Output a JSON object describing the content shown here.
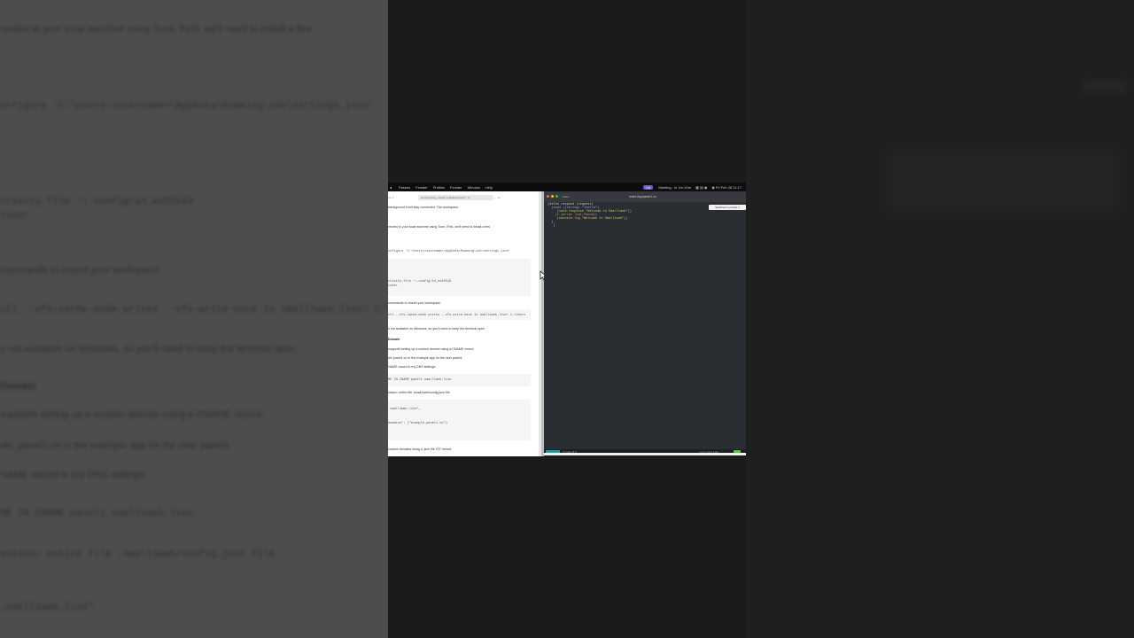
{
  "background_left": {
    "lines": [
      {
        "text": "nected to your local machine using Tunn. First, we'll need to install a few",
        "style": "text"
      },
      {
        "text": "onfigure 'C:\\Users\\<username>\\AppData\\Roaming\\ide\\settings.json'",
        "style": "mono"
      },
      {
        "text": "ctivity-file ~\\.config\\id_ed25519",
        "style": "mono"
      },
      {
        "text": "tuser",
        "style": "mono"
      },
      {
        "text": "commands to mount your workspace:",
        "style": "text"
      },
      {
        "text": "ctl --vfs-cache-mode writes --vfs-write-back 1s small1web_live\\ C:\\Users",
        "style": "mono"
      },
      {
        "text": "s not available on Windows, so you'll need to keep the terminal open",
        "style": "text"
      },
      {
        "text": "Domain",
        "style": "bold"
      },
      {
        "text": "supports setting up a custom domain using a CNAME record.",
        "style": "text"
      },
      {
        "text": "ain_panel1.vo in the example app for the user panel1",
        "style": "text"
      },
      {
        "text": "NAME record in my DNS settings:",
        "style": "text"
      },
      {
        "text": "ME IN CNAME panel1.small1web.live.",
        "style": "mono"
      },
      {
        "text": "ession: entire file .small1web/config.json file",
        "style": "mono"
      },
      {
        "text": ".small1web.live\"",
        "style": "mono"
      }
    ]
  },
  "menubar": {
    "apple": "●",
    "items": [
      "Passes",
      "Fenster",
      "Profiles",
      "Fenster",
      "Window",
      "Help"
    ],
    "pill": "OA",
    "status": [
      "Meeting · in 1hr 20m",
      "▦ ▤ ◉",
      "◉ Fri Feb 28 11:17"
    ]
  },
  "browser": {
    "toolbar_left": "◂ ▸ ⟳",
    "url": "summarizing_panel1.small1web.live/?.. ✕",
    "toolbar_right": "⋯ ⊞",
    "lines": [
      {
        "text": "background it will stay connected. The workspace.",
        "style": "text"
      },
      {
        "text": "nected to your local machine using Tunn. First, we'll need to install a few",
        "style": "text"
      },
      {
        "text": "onfigure 'C:\\Users\\<username>\\AppData\\Roaming\\ide\\settings.json'",
        "style": "mono"
      },
      {
        "text": "ctivity-file ~\\.config\\id_ed25519",
        "style": "mono"
      },
      {
        "text": "tuser",
        "style": "mono"
      },
      {
        "text": "commands to mount your workspace:",
        "style": "text"
      },
      {
        "text": "ctl --vfs-cache-mode writes --vfs-write-back 1s small1web_live\\ C:\\Users",
        "style": "mono"
      },
      {
        "text": "s not available on Windows, so you'll need to keep the terminal open",
        "style": "text"
      },
      {
        "text": "Domain",
        "style": "bold"
      },
      {
        "text": "supports setting up a custom domain using a CNAME record.",
        "style": "text"
      },
      {
        "text": "ain panel1.vo in the example app for the user panel1",
        "style": "text"
      },
      {
        "text": "NAME record in my DNS settings:",
        "style": "text"
      },
      {
        "text": "ME IN CNAME panel1.small1web.live.",
        "style": "mono"
      },
      {
        "text": "ession: entire file .small1web/config.json file",
        "style": "text"
      },
      {
        "text": ".small1web.live\",",
        "style": "mono"
      },
      {
        "text": "domains\": [\"example.panel1.vo\"]",
        "style": "mono"
      },
      {
        "text": "custom domains using a .json file *DT record",
        "style": "text"
      }
    ]
  },
  "editor": {
    "tab": "index",
    "window_title": "index.lisp/panel1.vo",
    "popup": "Switched to pocket ×",
    "code_lines": [
      {
        "text": "(defun respond (request)",
        "color": "#d0d0d0"
      },
      {
        "text": "  (cond ((string= \"/hello\")",
        "color": "#8fb8d8"
      },
      {
        "text": "     (send-response \"Welcome to Small1web\"))",
        "color": "#b5cc6a"
      },
      {
        "text": "",
        "color": "#d0d0d0"
      },
      {
        "text": "    (t (error 'not-found))",
        "color": "#d7a06a"
      },
      {
        "text": "     (console.log \"Welcome to Small1web\"))",
        "color": "#b5cc6a"
      },
      {
        "text": "  )",
        "color": "#d0d0d0"
      },
      {
        "text": "   )",
        "color": "#d0d0d0"
      }
    ],
    "status_left": "⎇ main ⊗ 0",
    "status_right": "Ln 1, Col 1  Lisp",
    "colors": {
      "background": "#2a2e32",
      "status_accent": "#3b8f9a",
      "status_ok": "#5fbf4a"
    }
  }
}
